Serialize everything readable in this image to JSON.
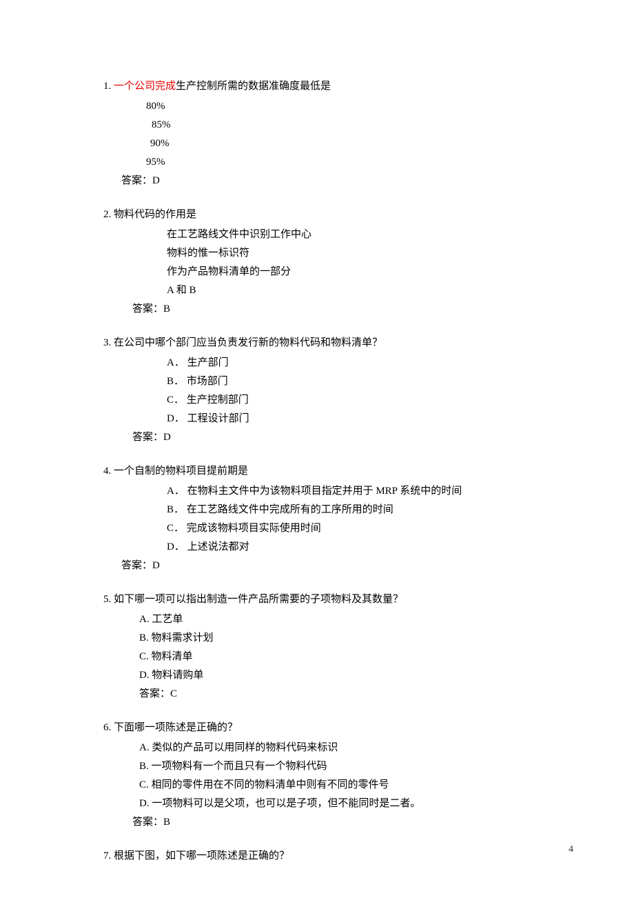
{
  "page_number": "4",
  "questions": [
    {
      "num": "1.  ",
      "stem_prefix_highlight": "一个公司完成",
      "stem_rest": "生产控制所需的数据准确度最低是",
      "options": [
        "80%",
        "85%",
        "90%",
        "95%"
      ],
      "answer_label": "答案：",
      "answer_value": "D"
    },
    {
      "num": "2.  ",
      "stem": "物料代码的作用是",
      "options": [
        "在工艺路线文件中识别工作中心",
        " 物料的惟一标识符",
        "作为产品物料清单的一部分",
        "A 和 B"
      ],
      "answer_label": "答案：",
      "answer_value": "B"
    },
    {
      "num": "3.  ",
      "stem": "在公司中哪个部门应当负责发行新的物料代码和物料清单？",
      "options": [
        "A．  生产部门",
        "B．   市场部门",
        "C．  生产控制部门",
        "D．  工程设计部门"
      ],
      "answer_label": "答案：",
      "answer_value": "D"
    },
    {
      "num": "4. ",
      "stem": "一个自制的物料项目提前期是",
      "options": [
        "A．  在物料主文件中为该物料项目指定并用于 MRP 系统中的时间",
        "B．  在工艺路线文件中完成所有的工序所用的时间",
        "C．  完成该物料项目实际使用时间",
        "D．  上述说法都对"
      ],
      "answer_label": "答案：",
      "answer_value": "D"
    },
    {
      "num": "5.  ",
      "stem": "如下哪一项可以指出制造一件产品所需要的子项物料及其数量？",
      "options": [
        "A.  工艺单",
        "B.  物料需求计划",
        "C.  物料清单",
        "D.  物料请购单"
      ],
      "answer_label": "答案：",
      "answer_value": "C"
    },
    {
      "num": "6.  ",
      "stem": "下面哪一项陈述是正确的？",
      "options": [
        "A.  类似的产品可以用同样的物料代码来标识",
        "B.  一项物料有一个而且只有一个物料代码",
        "C.  相同的零件用在不同的物料清单中则有不同的零件号",
        "D.  一项物料可以是父项，也可以是子项，但不能同时是二者。"
      ],
      "answer_label": "答案：",
      "answer_value": "B"
    },
    {
      "num": "7.  ",
      "stem": "根据下图，如下哪一项陈述是正确的？"
    }
  ]
}
